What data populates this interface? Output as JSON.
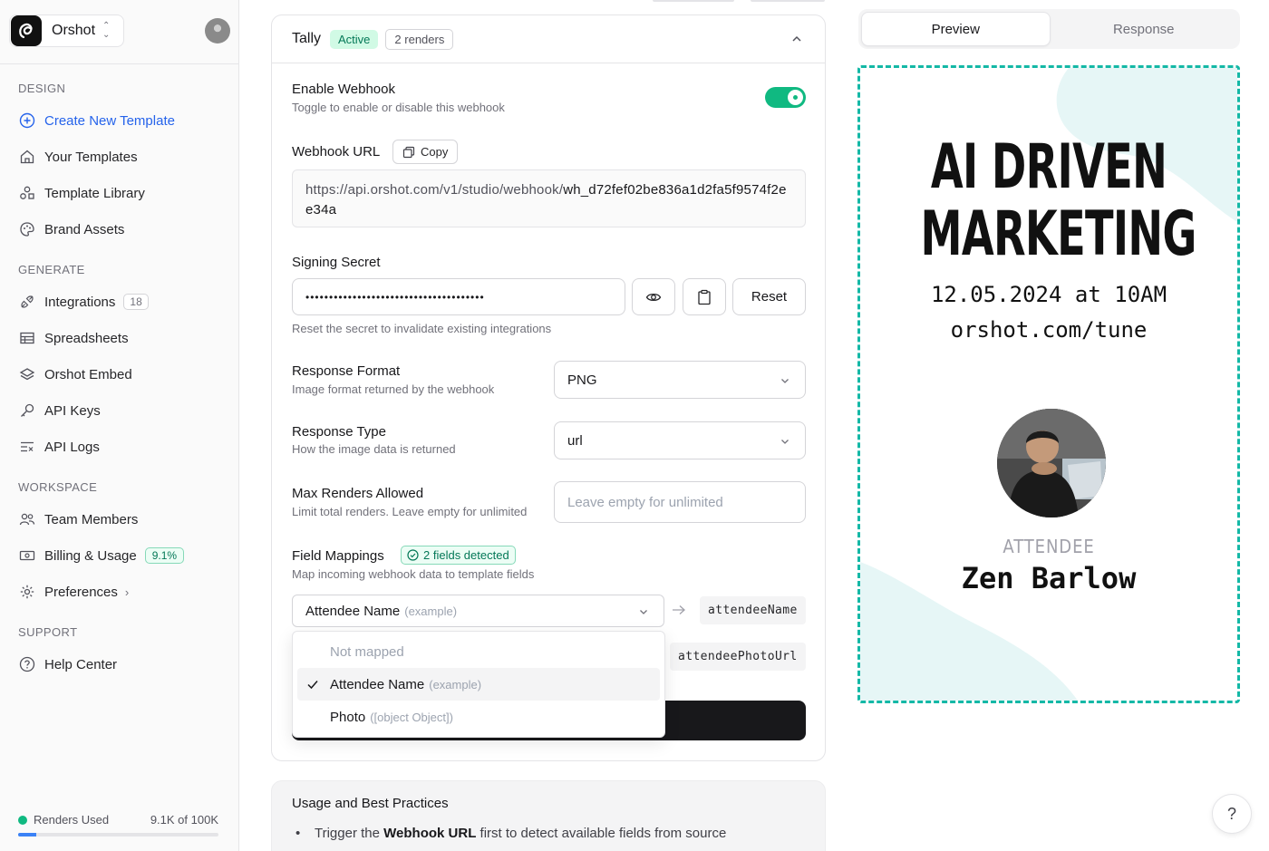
{
  "org": {
    "name": "Orshot"
  },
  "sidebar": {
    "sections": {
      "design": "DESIGN",
      "generate": "GENERATE",
      "workspace": "WORKSPACE",
      "support": "SUPPORT"
    },
    "items": {
      "create_template": "Create New Template",
      "your_templates": "Your Templates",
      "template_library": "Template Library",
      "brand_assets": "Brand Assets",
      "integrations": "Integrations",
      "integrations_count": "18",
      "spreadsheets": "Spreadsheets",
      "embed": "Orshot Embed",
      "api_keys": "API Keys",
      "api_logs": "API Logs",
      "team_members": "Team Members",
      "billing": "Billing & Usage",
      "billing_pct": "9.1%",
      "preferences": "Preferences",
      "help_center": "Help Center"
    },
    "renders": {
      "label": "Renders Used",
      "value": "9.1K of 100K",
      "fraction": 0.091
    }
  },
  "webhook": {
    "name": "Tally",
    "status": "Active",
    "renders": "2 renders",
    "enable": {
      "label": "Enable Webhook",
      "desc": "Toggle to enable or disable this webhook",
      "on": true
    },
    "url": {
      "label": "Webhook URL",
      "copy": "Copy",
      "prefix": "https://api.orshot.com/v1/studio/webhook/",
      "id": "wh_d72fef02be836a1d2fa5f9574f2ee34a"
    },
    "secret": {
      "label": "Signing Secret",
      "masked": "••••••••••••••••••••••••••••••••••••••",
      "reset": "Reset",
      "hint": "Reset the secret to invalidate existing integrations"
    },
    "response_format": {
      "label": "Response Format",
      "desc": "Image format returned by the webhook",
      "value": "PNG"
    },
    "response_type": {
      "label": "Response Type",
      "desc": "How the image data is returned",
      "value": "url"
    },
    "max_renders": {
      "label": "Max Renders Allowed",
      "desc": "Limit total renders. Leave empty for unlimited",
      "placeholder": "Leave empty for unlimited"
    },
    "mappings": {
      "label": "Field Mappings",
      "detected": "2 fields detected",
      "desc": "Map incoming webhook data to template fields",
      "row1": {
        "source": "Attendee Name",
        "source_hint": "(example)",
        "target": "attendeeName"
      },
      "row2": {
        "target": "attendeePhotoUrl"
      },
      "dropdown": [
        {
          "label": "Not mapped",
          "hint": ""
        },
        {
          "label": "Attendee Name",
          "hint": "(example)"
        },
        {
          "label": "Photo",
          "hint": "([object Object])"
        }
      ]
    }
  },
  "usage": {
    "title": "Usage and Best Practices",
    "item_pre": "Trigger the ",
    "item_strong": "Webhook URL",
    "item_post": " first to detect available fields from source"
  },
  "preview": {
    "tabs": [
      "Preview",
      "Response"
    ],
    "title_line1": "AI DRIVEN",
    "title_line2": "MARKETING",
    "date": "12.05.2024 at 10AM",
    "url": "orshot.com/tune",
    "role": "ATTENDEE",
    "name": "Zen Barlow",
    "colors": {
      "accent": "#14b8a6",
      "blob": "#e6f6f6"
    }
  },
  "help": "?"
}
